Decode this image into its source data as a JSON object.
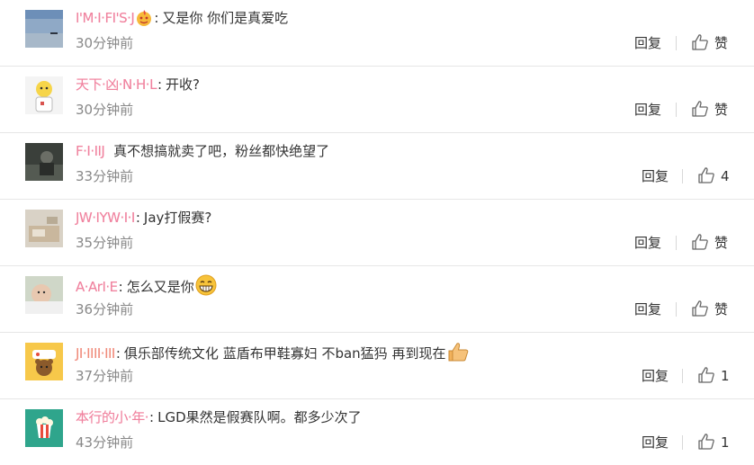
{
  "labels": {
    "reply": "回复",
    "like": "赞"
  },
  "comments": [
    {
      "username": "I'M·I·FI'S·J",
      "username_icon": "fire-emoji",
      "text": "又是你 你们是真爱吃",
      "time": "30分钟前",
      "reply_label": "回复",
      "like_label": "赞",
      "avatar": "seascape"
    },
    {
      "username": "天下·凶·N·H·L",
      "text": "开收?",
      "time": "30分钟前",
      "reply_label": "回复",
      "like_label": "赞",
      "avatar": "cartoon-figure"
    },
    {
      "username": "F·I·IIJ",
      "text": "真不想搞就卖了吧，粉丝都快绝望了",
      "time": "33分钟前",
      "reply_label": "回复",
      "like_label": "4",
      "avatar": "dark-photo"
    },
    {
      "username": "JW·IYW·I·I",
      "text": "Jay打假赛?",
      "time": "35分钟前",
      "reply_label": "回复",
      "like_label": "赞",
      "avatar": "paper-photo"
    },
    {
      "username": "A·ArI·E",
      "text": "怎么又是你",
      "text_emoji": "grin-emoji",
      "time": "36分钟前",
      "reply_label": "回复",
      "like_label": "赞",
      "avatar": "baby-photo"
    },
    {
      "username": "JI·IIII·III",
      "text": "俱乐部传统文化 蓝盾布甲鞋寡妇 不ban猛犸 再到现在",
      "text_emoji": "thumbs-up-emoji",
      "time": "37分钟前",
      "reply_label": "回复",
      "like_label": "1",
      "avatar": "bear-sticker"
    },
    {
      "username": "本行的小·年·",
      "text": "LGD果然是假赛队啊。都多少次了",
      "time": "43分钟前",
      "reply_label": "回复",
      "like_label": "1",
      "avatar": "popcorn-icon"
    }
  ],
  "colors": {
    "username": "#f0839f",
    "time": "#888888",
    "text": "#333333",
    "divider": "#e6e6e6"
  }
}
